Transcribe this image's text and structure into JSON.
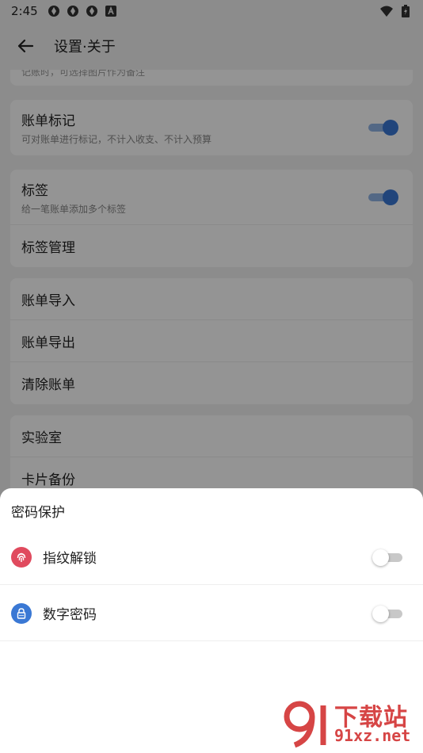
{
  "status_bar": {
    "time": "2:45",
    "left_icons": [
      "sync-icon",
      "sync-icon",
      "sync-icon",
      "a-box-icon"
    ],
    "right_icons": [
      "wifi-icon",
      "battery-icon"
    ]
  },
  "toolbar": {
    "title": "设置·关于"
  },
  "cut_row": {
    "subtitle": "记账时，可选择图片作为备注"
  },
  "sections": [
    {
      "rows": [
        {
          "title": "账单标记",
          "subtitle": "可对账单进行标记，不计入收支、不计入预算",
          "toggle": true
        }
      ]
    },
    {
      "rows": [
        {
          "title": "标签",
          "subtitle": "给一笔账单添加多个标签",
          "toggle": true
        },
        {
          "title": "标签管理"
        }
      ]
    },
    {
      "rows": [
        {
          "title": "账单导入"
        },
        {
          "title": "账单导出"
        },
        {
          "title": "清除账单"
        }
      ]
    },
    {
      "rows": [
        {
          "title": "实验室"
        },
        {
          "title": "卡片备份"
        }
      ]
    }
  ],
  "sheet": {
    "title": "密码保护",
    "items": [
      {
        "label": "指纹解锁",
        "icon": "fingerprint-icon",
        "icon_color": "#e04a5e",
        "enabled": false
      },
      {
        "label": "数字密码",
        "icon": "lock-icon",
        "icon_color": "#3a78d4",
        "enabled": false
      }
    ]
  },
  "watermark": {
    "text": "下载站",
    "url": "91xz.net"
  },
  "colors": {
    "accent": "#3a78d4",
    "fingerprint": "#e04a5e",
    "watermark": "#d64545"
  }
}
